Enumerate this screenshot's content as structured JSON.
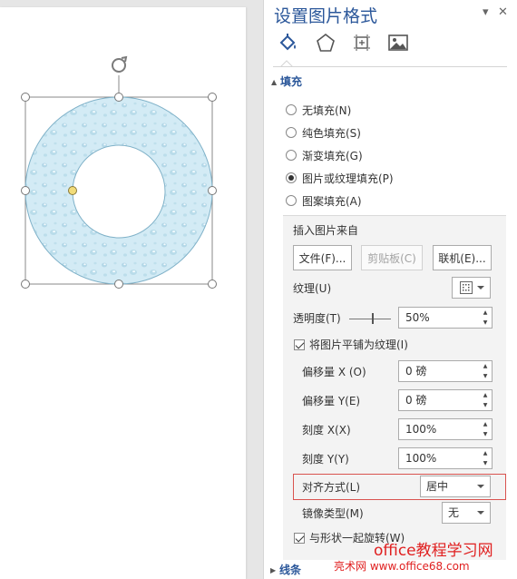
{
  "pane": {
    "title": "设置图片格式",
    "dropdown_icon": "▾",
    "close_icon": "✕",
    "tabs": [
      {
        "name": "fill-line",
        "icon": "paint-bucket-icon"
      },
      {
        "name": "effects",
        "icon": "pentagon-icon"
      },
      {
        "name": "size-properties",
        "icon": "size-position-icon"
      },
      {
        "name": "picture",
        "icon": "picture-icon"
      }
    ]
  },
  "fill": {
    "section_label": "填充",
    "options": [
      {
        "label": "无填充(N)",
        "checked": false
      },
      {
        "label": "纯色填充(S)",
        "checked": false
      },
      {
        "label": "渐变填充(G)",
        "checked": false
      },
      {
        "label": "图片或纹理填充(P)",
        "checked": true
      },
      {
        "label": "图案填充(A)",
        "checked": false
      }
    ],
    "insert_from_label": "插入图片来自",
    "file_button": "文件(F)...",
    "clipboard_button": "剪贴板(C)",
    "online_button": "联机(E)...",
    "texture_label": "纹理(U)",
    "transparency_label": "透明度(T)",
    "transparency_value": "50%",
    "transparency_fraction": 0.5,
    "tile_label": "将图片平铺为纹理(I)",
    "tile_checked": true,
    "offset_x_label": "偏移量 X (O)",
    "offset_x_value": "0 磅",
    "offset_y_label": "偏移量 Y(E)",
    "offset_y_value": "0 磅",
    "scale_x_label": "刻度 X(X)",
    "scale_x_value": "100%",
    "scale_y_label": "刻度 Y(Y)",
    "scale_y_value": "100%",
    "alignment_label": "对齐方式(L)",
    "alignment_value": "居中",
    "mirror_label": "镜像类型(M)",
    "mirror_value": "无",
    "rotate_label": "与形状一起旋转(W)",
    "rotate_checked": true
  },
  "line": {
    "section_label": "线条"
  },
  "watermark": {
    "line1": "office教程学习网",
    "line2": "亮术网 www.office68.com"
  },
  "colors": {
    "accent": "#2b579a",
    "highlight": "#d9534f",
    "watermark": "#e02020",
    "shape_fill": "#cfe9f4"
  }
}
